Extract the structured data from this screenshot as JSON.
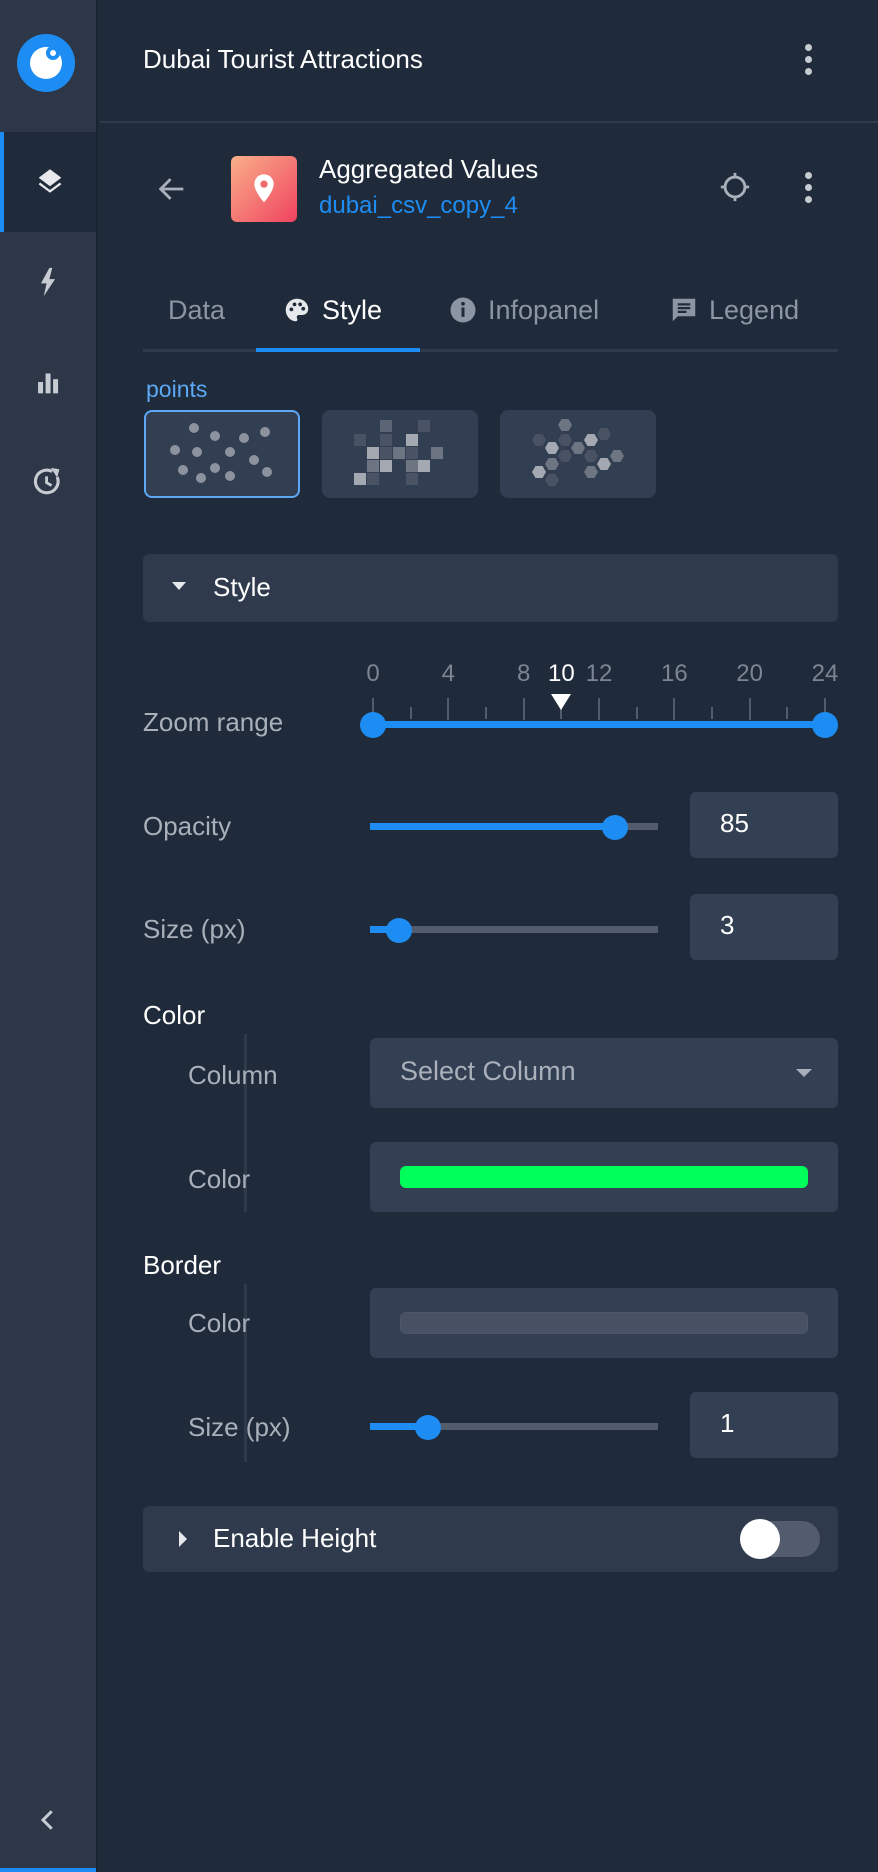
{
  "app": {
    "title": "Dubai Tourist Attractions"
  },
  "sidebar": {
    "items": [
      {
        "name": "layers",
        "icon": "layers-icon",
        "active": true
      },
      {
        "name": "analysis",
        "icon": "lightning-icon",
        "active": false
      },
      {
        "name": "widgets",
        "icon": "bar-chart-icon",
        "active": false
      },
      {
        "name": "history",
        "icon": "history-icon",
        "active": false
      }
    ],
    "collapse_icon": "chevron-left-icon"
  },
  "layer": {
    "name": "Aggregated Values",
    "source": "dubai_csv_copy_4",
    "icon": "map-pin-icon"
  },
  "tabs": [
    {
      "label": "Data",
      "icon": "",
      "active": false
    },
    {
      "label": "Style",
      "icon": "palette-icon",
      "active": true
    },
    {
      "label": "Infopanel",
      "icon": "info-icon",
      "active": false
    },
    {
      "label": "Legend",
      "icon": "comment-icon",
      "active": false
    }
  ],
  "geometry": {
    "label": "points",
    "options": [
      {
        "name": "points",
        "selected": true
      },
      {
        "name": "squares",
        "selected": false
      },
      {
        "name": "hexagons",
        "selected": false
      }
    ]
  },
  "style_section": {
    "title": "Style",
    "expanded": true
  },
  "zoom_range": {
    "label": "Zoom range",
    "ticks": [
      "0",
      "4",
      "8",
      "10",
      "12",
      "16",
      "20",
      "24"
    ],
    "current_zoom": 10,
    "min": 0,
    "max": 24,
    "range": [
      0,
      24
    ]
  },
  "opacity": {
    "label": "Opacity",
    "value": "85",
    "fraction": 0.85
  },
  "size": {
    "label": "Size (px)",
    "value": "3",
    "fraction": 0.1
  },
  "color_group": {
    "title": "Color",
    "column_label": "Column",
    "column_placeholder": "Select Column",
    "color_label": "Color",
    "color_value": "#00ff5a"
  },
  "border_group": {
    "title": "Border",
    "color_label": "Color",
    "color_value": "#475163",
    "size_label": "Size (px)",
    "size_value": "1",
    "size_fraction": 0.2
  },
  "height_section": {
    "title": "Enable Height",
    "enabled": false
  },
  "colors": {
    "accent": "#1e8df3",
    "background": "#1f2b3a",
    "sidebar": "#2d3748"
  }
}
